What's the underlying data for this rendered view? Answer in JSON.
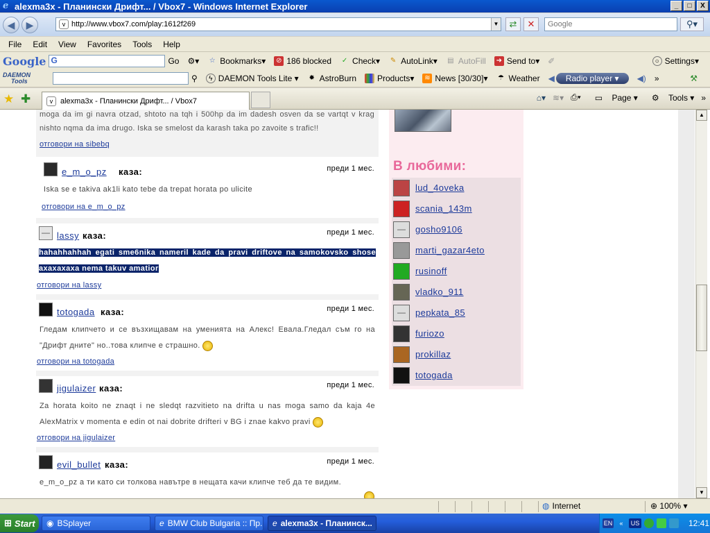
{
  "window": {
    "title": "alexma3x - Планински Дрифт... / Vbox7 - Windows Internet Explorer",
    "buttons": [
      "_",
      "□",
      "X"
    ]
  },
  "nav": {
    "url": "http://www.vbox7.com/play:1612f269",
    "search_placeholder": "Google"
  },
  "menu": [
    "File",
    "Edit",
    "View",
    "Favorites",
    "Tools",
    "Help"
  ],
  "google_toolbar": {
    "logo": "Google",
    "combo_value": "G",
    "go": "Go",
    "bookmarks": "Bookmarks",
    "blocked": "186 blocked",
    "check": "Check",
    "autolink": "AutoLink",
    "autofill": "AutoFill",
    "sendto": "Send to",
    "settings": "Settings"
  },
  "daemon_toolbar": {
    "logo_line1": "DAEMON",
    "logo_line2": "Tools",
    "lite": "DAEMON Tools Lite",
    "astroburn": "AstroBurn",
    "products": "Products",
    "news": "News [30/30]",
    "weather": "Weather",
    "radio": "Radio player"
  },
  "tab": {
    "title": "alexma3x - Планински Дрифт... / Vbox7"
  },
  "command_bar": {
    "page": "Page",
    "tools": "Tools"
  },
  "comments": {
    "top_fragment": {
      "text": "moga da im gi navra otzad, shtoto na tqh i 500hp da im dadesh osven da se vartqt v krag nishto nqma da ima drugo. Iska se smelost da karash taka po zavoite s trafic!!",
      "reply": "отговори на sibebq"
    },
    "items": [
      {
        "user": "e_m_o_pz",
        "said": "каза:",
        "time": "преди 1 мес.",
        "text": "Iska se e takiva ak1li kato tebe da trepat horata po ulicite",
        "reply": "отговори на e_m_o_pz",
        "avatar_color": "#2a2a2a"
      },
      {
        "user": "lassy",
        "said": "каза:",
        "time": "преди 1 мес.",
        "text": "hahahhahhah egati sme6nika nameril kade da pravi driftove na samokovsko shose ахахахаха nema takuv amatior",
        "reply": "отговори на lassy",
        "avatar_color": "#e4e4e4"
      },
      {
        "user": "totogada",
        "said": "каза:",
        "time": "преди 1 мес.",
        "text": "Гледам клипчето и се възхищавам на уменията на Алекс! Евала.Гледал съм го на \"Дрифт дните\" но..това клипче е страшно.",
        "reply": "отговори на totogada",
        "avatar_color": "#111111"
      },
      {
        "user": "jigulaizer",
        "said": "каза:",
        "time": "преди 1 мес.",
        "text": "Za horata koito ne znaqt i ne sledqt razvitieto na drifta u nas moga samo da kaja 4e AlexMatrix v momenta e edin ot nai dobrite drifteri v BG i znae kakvo pravi",
        "reply": "отговори на jigulaizer",
        "avatar_color": "#333333"
      },
      {
        "user": "evil_bullet",
        "said": "каза:",
        "time": "преди 1 мес.",
        "text": "e_m_o_pz а ти като си толкова навътре в нещата качи клипче теб да те видим.",
        "reply": "",
        "avatar_color": "#222222"
      }
    ]
  },
  "favorites": {
    "title": "В любими:",
    "items": [
      {
        "name": "lud_4oveka",
        "color": "#b44"
      },
      {
        "name": "scania_143m",
        "color": "#c22"
      },
      {
        "name": "gosho9106",
        "color": "#ddd"
      },
      {
        "name": "marti_gazar4eto",
        "color": "#999"
      },
      {
        "name": "rusinoff",
        "color": "#2a2"
      },
      {
        "name": "vladko_911",
        "color": "#665"
      },
      {
        "name": "pepkata_85",
        "color": "#ddd"
      },
      {
        "name": "furiozo",
        "color": "#333"
      },
      {
        "name": "prokillaz",
        "color": "#a62"
      },
      {
        "name": "totogada",
        "color": "#111"
      }
    ]
  },
  "status": {
    "zone": "Internet",
    "zoom": "100%"
  },
  "taskbar": {
    "start": "Start",
    "tasks": [
      "BSplayer",
      "BMW Club Bulgaria :: Пр...",
      "alexma3x - Планинск..."
    ],
    "lang": "EN",
    "layout": "US",
    "clock": "12:41"
  }
}
